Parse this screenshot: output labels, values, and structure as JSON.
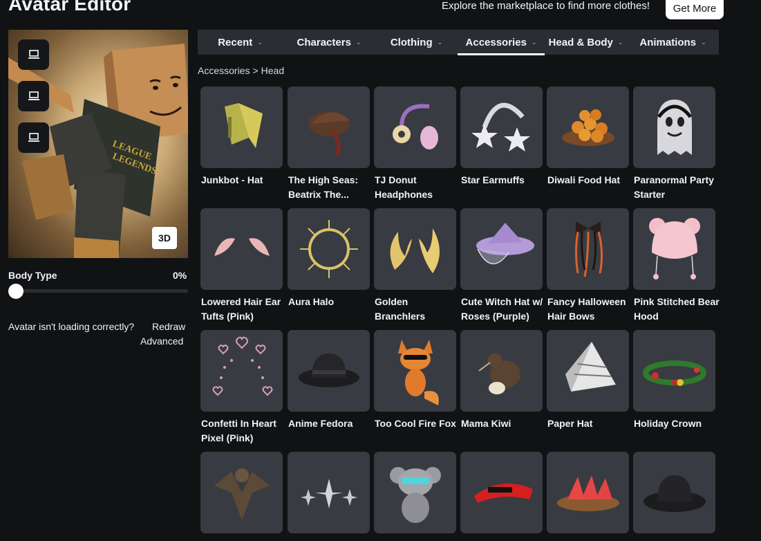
{
  "header": {
    "title": "Avatar Editor",
    "explore_text": "Explore the marketplace to find more clothes!",
    "get_more_label": "Get More"
  },
  "avatar_panel": {
    "tool_icons": [
      "monitor-icon",
      "monitor-icon",
      "monitor-icon"
    ],
    "view_3d_label": "3D",
    "body_type_label": "Body Type",
    "body_type_value": "0%",
    "body_type_fraction": 0,
    "loading_message": "Avatar isn't loading correctly?",
    "redraw_label": "Redraw",
    "advanced_label": "Advanced"
  },
  "tabs": [
    {
      "label": "Recent",
      "active": false
    },
    {
      "label": "Characters",
      "active": false
    },
    {
      "label": "Clothing",
      "active": false
    },
    {
      "label": "Accessories",
      "active": true
    },
    {
      "label": "Head & Body",
      "active": false
    },
    {
      "label": "Animations",
      "active": false
    }
  ],
  "breadcrumb": {
    "parent": "Accessories",
    "separator": ">",
    "current": "Head"
  },
  "items": [
    {
      "name": "Junkbot - Hat",
      "icon": "junkbot-hat-icon"
    },
    {
      "name": "The High Seas: Beatrix The...",
      "icon": "pirate-hat-icon"
    },
    {
      "name": "TJ Donut Headphones",
      "icon": "donut-headphones-icon"
    },
    {
      "name": "Star Earmuffs",
      "icon": "star-earmuffs-icon"
    },
    {
      "name": "Diwali Food Hat",
      "icon": "food-plate-icon"
    },
    {
      "name": "Paranormal Party Starter",
      "icon": "ghost-icon"
    },
    {
      "name": "Lowered Hair Ear Tufts (Pink)",
      "icon": "ear-tufts-icon"
    },
    {
      "name": "Aura Halo",
      "icon": "halo-icon"
    },
    {
      "name": "Golden Branchlers",
      "icon": "golden-antlers-icon"
    },
    {
      "name": "Cute Witch Hat w/ Roses (Purple)",
      "icon": "witch-hat-icon"
    },
    {
      "name": "Fancy Halloween Hair Bows",
      "icon": "hair-bows-icon"
    },
    {
      "name": "Pink Stitched Bear Hood",
      "icon": "bear-hood-icon"
    },
    {
      "name": "Confetti In Heart Pixel (Pink)",
      "icon": "heart-confetti-icon"
    },
    {
      "name": "Anime Fedora",
      "icon": "fedora-icon"
    },
    {
      "name": "Too Cool Fire Fox",
      "icon": "fox-icon"
    },
    {
      "name": "Mama Kiwi",
      "icon": "kiwi-bird-icon"
    },
    {
      "name": "Paper Hat",
      "icon": "paper-hat-icon"
    },
    {
      "name": "Holiday Crown",
      "icon": "holly-crown-icon"
    },
    {
      "name": "",
      "icon": "dragon-icon"
    },
    {
      "name": "",
      "icon": "sparkles-icon"
    },
    {
      "name": "",
      "icon": "koala-icon"
    },
    {
      "name": "",
      "icon": "red-visor-icon"
    },
    {
      "name": "",
      "icon": "watermelon-plate-icon"
    },
    {
      "name": "",
      "icon": "black-bucket-hat-icon"
    }
  ],
  "colors": {
    "background": "#111214",
    "tab_bar": "#2b2d33",
    "thumb_bg": "#393b42",
    "accent_white": "#ffffff"
  }
}
